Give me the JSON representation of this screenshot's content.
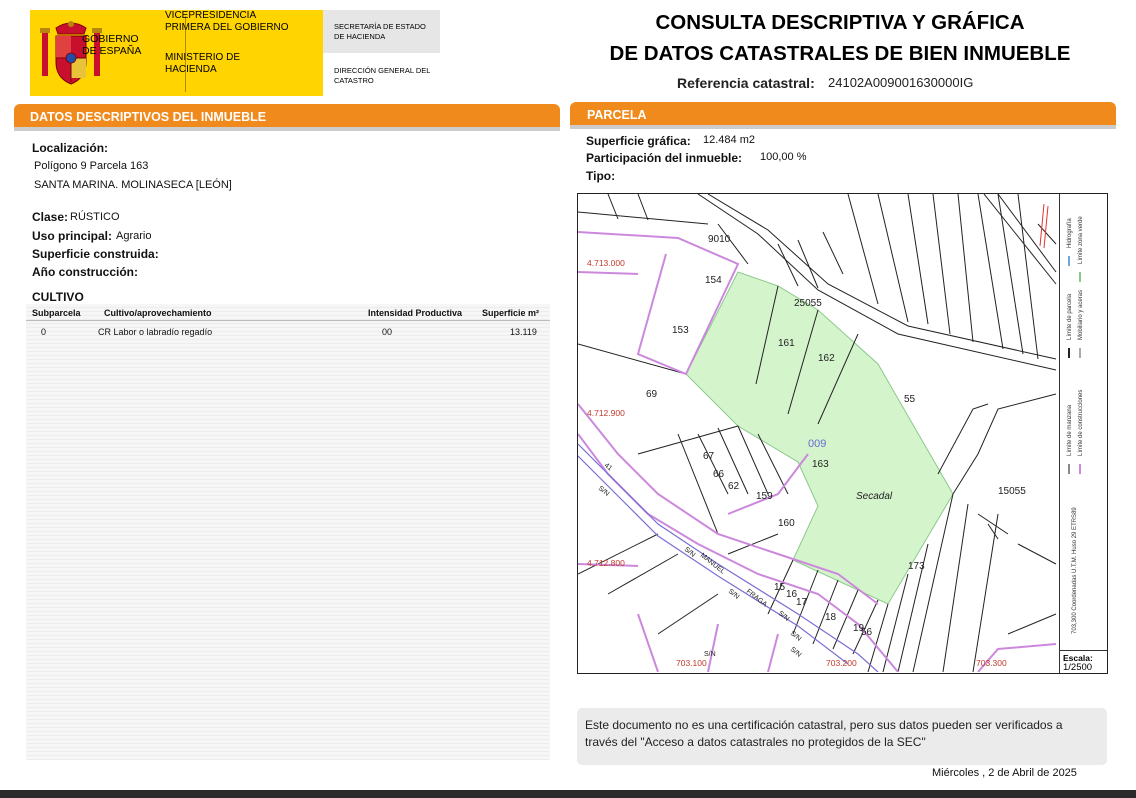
{
  "header": {
    "gov_name": "GOBIERNO DE ESPAÑA",
    "vicepresidencia": "VICEPRESIDENCIA PRIMERA DEL GOBIERNO",
    "ministerio": "MINISTERIO DE HACIENDA",
    "secretaria": "SECRETARÍA DE ESTADO DE HACIENDA",
    "direccion": "DIRECCIÓN GENERAL DEL CATASTRO",
    "title_line1": "CONSULTA DESCRIPTIVA Y GRÁFICA",
    "title_line2": "DE DATOS CATASTRALES DE BIEN INMUEBLE",
    "ref_label": "Referencia catastral:",
    "ref_value": "24102A009001630000IG",
    "brand_color": "#ffd400"
  },
  "descriptive": {
    "section_title": "DATOS DESCRIPTIVOS DEL INMUEBLE",
    "localizacion_label": "Localización:",
    "localizacion_line1": "Polígono 9 Parcela 163",
    "localizacion_line2": "SANTA MARINA. MOLINASECA [LEÓN]",
    "clase_label": "Clase:",
    "clase_value": "RÚSTICO",
    "uso_label": "Uso principal:",
    "uso_value": "Agrario",
    "sup_construida_label": "Superficie construida:",
    "ano_label": "Año construcción:",
    "accent_color": "#f08a1c"
  },
  "cultivo": {
    "title": "CULTIVO",
    "headers": [
      "Subparcela",
      "Cultivo/aprovechamiento",
      "Intensidad Productiva",
      "Superficie m²"
    ],
    "rows": [
      [
        "0",
        "CR Labor o labradío regadío",
        "00",
        "13.119"
      ]
    ]
  },
  "parcela": {
    "section_title": "PARCELA",
    "superficie_label": "Superficie gráfica:",
    "superficie_value": "12.484 m2",
    "participacion_label": "Participación del inmueble:",
    "participacion_value": "100,00 %",
    "tipo_label": "Tipo:"
  },
  "map": {
    "parcel_fill": "#d4f5cc",
    "boundary_color": "#cc88dd",
    "coord_color": "#c0392b",
    "grid_labels_y": [
      "4.713.000",
      "4.712.900",
      "4.712.800"
    ],
    "grid_labels_x": [
      "703.100",
      "703.200",
      "703.300"
    ],
    "polygon_label": "009",
    "place_label": "Secadal",
    "parcel_numbers": [
      "9010",
      "154",
      "25055",
      "153",
      "161",
      "162",
      "55",
      "69",
      "67",
      "66",
      "62",
      "163",
      "159",
      "160",
      "15055",
      "173",
      "15",
      "16",
      "17",
      "18",
      "19",
      "56"
    ],
    "road_labels": [
      "S/N",
      "S/N",
      "S/N",
      "S/N",
      "S/N",
      "MANUEL",
      "FRAGA",
      "S/N",
      "S/N",
      "41"
    ],
    "legend_items": [
      "Límite de manzana",
      "Límite de construcciones",
      "Límite de parcela",
      "Mobiliario y aceras",
      "Hidrografía",
      "Límite zona verde"
    ],
    "coord_system": "703,300 Coordenadas U.T.M. Huso 29 ETRS89",
    "scale_label": "Escala:",
    "scale_value": "1/2500"
  },
  "footer": {
    "note": "Este documento no es una certificación catastral, pero sus datos pueden ser verificados a través del \"Acceso a datos catastrales no protegidos de la SEC\"",
    "date": "Miércoles , 2 de Abril de 2025"
  }
}
